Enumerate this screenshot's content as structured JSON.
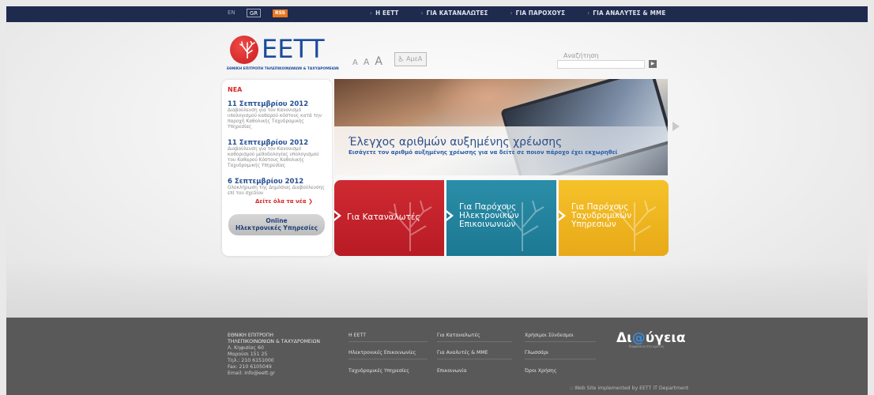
{
  "topbar": {
    "lang_en": "EN",
    "lang_gr": "GR",
    "rss": "RSS",
    "nav": [
      {
        "label": "Η ΕΕΤΤ"
      },
      {
        "label": "ΓΙΑ ΚΑΤΑΝΑΛΩΤΕΣ"
      },
      {
        "label": "ΓΙΑ ΠΑΡΟΧΟΥΣ"
      },
      {
        "label": "ΓΙΑ ΑΝΑΛΥΤΕΣ & ΜΜΕ"
      }
    ]
  },
  "logo": {
    "name": "ΕΕΤΤ",
    "subtitle": "ΕΘΝΙΚΗ ΕΠΙΤΡΟΠΗ ΤΗΛΕΠΙΚΟΙΝΩΝΙΩΝ & ΤΑΧΥΔΡΟΜΕΙΩΝ"
  },
  "tools": {
    "font_small": "A",
    "font_medium": "A",
    "font_large": "A",
    "amea": "ΑμεΑ"
  },
  "search": {
    "label": "Αναζήτηση",
    "value": "",
    "button_icon": "play-icon"
  },
  "news": {
    "heading": "ΝΕΑ",
    "items": [
      {
        "date": "11 Σεπτεμβρίου 2012",
        "text": "Διαβούλευση για τον Κανονισμό υπολογισμού καθαρού κόστους κατά την παροχή Καθολικής Ταχυδρομικής Υπηρεσίας"
      },
      {
        "date": "11 Σεπτεμβρίου 2012",
        "text": "Διαβούλευση για τον Κανονισμό καθορισμού μεθοδολογίας υπολογισμού του Καθαρού Κόστους Καθολικής Ταχυδρομικής Υπηρεσίας"
      },
      {
        "date": "6 Σεπτεμβρίου 2012",
        "text": "Ολοκλήρωση της Δημόσιας Διαβούλευσης επί του σχεδίου"
      }
    ],
    "more": "Δείτε όλα τα νέα",
    "online_line1": "Online",
    "online_line2": "Ηλεκτρονικές Υπηρεσίες"
  },
  "banner": {
    "title": "Έλεγχος αριθμών αυξημένης χρέωσης",
    "subtitle": "Εισάγετε τον αριθμό αυξημένης χρέωσης για να δείτε σε ποιον πάροχο έχει εκχωρηθεί"
  },
  "tiles": [
    {
      "lines": [
        "Για Καταναλωτές"
      ],
      "color": "#c82330"
    },
    {
      "lines": [
        "Για Παρόχους",
        "Ηλεκτρονικών",
        "Επικοινωνιών"
      ],
      "color": "#23849e"
    },
    {
      "lines": [
        "Για Παρόχους",
        "Ταχυδρομικών",
        "Υπηρεσιών"
      ],
      "color": "#efb620"
    }
  ],
  "footer": {
    "org_line1": "ΕΘΝΙΚΗ ΕΠΙΤΡΟΠΗ",
    "org_line2": "ΤΗΛΕΠΙΚΟΙΝΩΝΙΩΝ & ΤΑΧΥΔΡΟΜΕΙΩΝ",
    "address1": "Λ. Κηφισίας 60",
    "address2": "Μαρούσι 151 25",
    "phone": "Τηλ.: 210 6151000",
    "fax": "Fax: 210 6105049",
    "email": "Email: info@eett.gr",
    "col2": [
      "Η ΕΕΤΤ",
      "Ηλεκτρονικές Επικοινωνίες",
      "Ταχυδρομικές Υπηρεσίες"
    ],
    "col3": [
      "Για Καταναλωτές",
      "Για Αναλυτές & ΜΜΕ",
      "Επικοινωνία"
    ],
    "col4": [
      "Χρήσιμοι Σύνδεσμοι",
      "Γλωσσάρι",
      "Όροι Χρήσης"
    ],
    "diavgeia_pre": "Δι",
    "diavgeia_at": "@",
    "diavgeia_post": "ύγεια",
    "diavgeia_sub": "διαφάνεια στο κράτος",
    "credit": ":: Web Site implemented by EETT IT Department"
  }
}
